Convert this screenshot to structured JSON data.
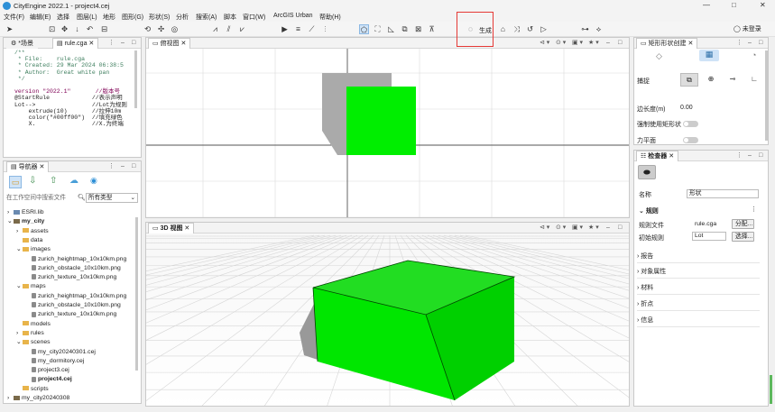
{
  "window": {
    "title": "CityEngine 2022.1 - project4.cej",
    "minimize": "—",
    "maximize": "□",
    "close": "✕"
  },
  "menu": [
    "文件(F)",
    "编辑(E)",
    "选择",
    "图层(L)",
    "地形",
    "图形(G)",
    "形状(S)",
    "分析",
    "搜索(A)",
    "脚本",
    "窗口(W)",
    "ArcGIS Urban",
    "帮助(H)"
  ],
  "account": "未登录",
  "toolbar": {
    "generate_label": "生成"
  },
  "rule_editor": {
    "tabs": [
      "*场景",
      "rule.cga"
    ],
    "code": [
      {
        "cls": "cmt",
        "text": "/**"
      },
      {
        "cls": "cmt",
        "text": " * File:    rule.cga"
      },
      {
        "cls": "cmt",
        "text": " * Created: 29 Mar 2024 06:38:5"
      },
      {
        "cls": "cmt",
        "text": " * Author:  Great white pan"
      },
      {
        "cls": "cmt",
        "text": " */"
      },
      {
        "cls": "",
        "text": ""
      },
      {
        "cls": "kw",
        "text": "version \"2022.1\"       //版本号"
      },
      {
        "cls": "",
        "text": "@StartRule            //表示声明"
      },
      {
        "cls": "",
        "text": "Lot-->                //Lot为规则"
      },
      {
        "cls": "",
        "text": "    extrude(10)       //拉伸10m"
      },
      {
        "cls": "",
        "text": "    color(\"#00ff00\")  //填充绿色"
      },
      {
        "cls": "",
        "text": "    X.                //X.为终端"
      }
    ]
  },
  "navigator": {
    "title": "导航器",
    "search_placeholder": "在工作空间中搜索文件",
    "filter_value": "所有类型",
    "items": [
      {
        "label": "ESRI.lib",
        "depth": 0,
        "kind": "lib",
        "arrow": "›"
      },
      {
        "label": "my_city",
        "depth": 0,
        "kind": "proj",
        "arrow": "⌄",
        "bold": true
      },
      {
        "label": "assets",
        "depth": 1,
        "kind": "folder",
        "arrow": "›"
      },
      {
        "label": "data",
        "depth": 1,
        "kind": "folder",
        "arrow": ""
      },
      {
        "label": "images",
        "depth": 1,
        "kind": "folder",
        "arrow": "⌄"
      },
      {
        "label": "zurich_heightmap_10x10km.png",
        "depth": 2,
        "kind": "file",
        "arrow": ""
      },
      {
        "label": "zurich_obstacle_10x10km.png",
        "depth": 2,
        "kind": "file",
        "arrow": ""
      },
      {
        "label": "zurich_texture_10x10km.png",
        "depth": 2,
        "kind": "file",
        "arrow": ""
      },
      {
        "label": "maps",
        "depth": 1,
        "kind": "folder",
        "arrow": "⌄"
      },
      {
        "label": "zurich_heightmap_10x10km.png",
        "depth": 2,
        "kind": "file",
        "arrow": ""
      },
      {
        "label": "zurich_obstacle_10x10km.png",
        "depth": 2,
        "kind": "file",
        "arrow": ""
      },
      {
        "label": "zurich_texture_10x10km.png",
        "depth": 2,
        "kind": "file",
        "arrow": ""
      },
      {
        "label": "models",
        "depth": 1,
        "kind": "folder",
        "arrow": ""
      },
      {
        "label": "rules",
        "depth": 1,
        "kind": "folder",
        "arrow": "›"
      },
      {
        "label": "scenes",
        "depth": 1,
        "kind": "folder",
        "arrow": "⌄"
      },
      {
        "label": "my_city20240301.cej",
        "depth": 2,
        "kind": "file",
        "arrow": ""
      },
      {
        "label": "my_dormitory.cej",
        "depth": 2,
        "kind": "file",
        "arrow": ""
      },
      {
        "label": "project3.cej",
        "depth": 2,
        "kind": "file",
        "arrow": ""
      },
      {
        "label": "project4.cej",
        "depth": 2,
        "kind": "file",
        "arrow": "",
        "bold": true
      },
      {
        "label": "scripts",
        "depth": 1,
        "kind": "folder",
        "arrow": ""
      },
      {
        "label": "my_city20240308",
        "depth": 0,
        "kind": "proj",
        "arrow": "›"
      }
    ]
  },
  "top_view": {
    "title": "俯视图"
  },
  "view3d": {
    "title": "3D 视图"
  },
  "colors": {
    "accent_green": "#00ee00",
    "highlight_red": "#e53935",
    "selection_blue": "#cfe3f7"
  },
  "shape_panel": {
    "title": "矩形形状创建",
    "snap_label": "捕捉",
    "edge_length_label": "边长度(m)",
    "edge_length_value": "0.00",
    "force_rect_label": "强制使用矩形状",
    "force_plane_label": "力平面"
  },
  "inspector": {
    "title": "检查器",
    "name_label": "名称",
    "name_value": "形状",
    "rules_section": "规则",
    "rule_file_label": "规则文件",
    "rule_file_value": "rule.cga",
    "assign_button": "分配...",
    "start_rule_label": "初始规则",
    "start_rule_value": "Lot",
    "select_button": "选择...",
    "sections": [
      "报告",
      "对象属性",
      "材料",
      "折点",
      "信息"
    ]
  }
}
